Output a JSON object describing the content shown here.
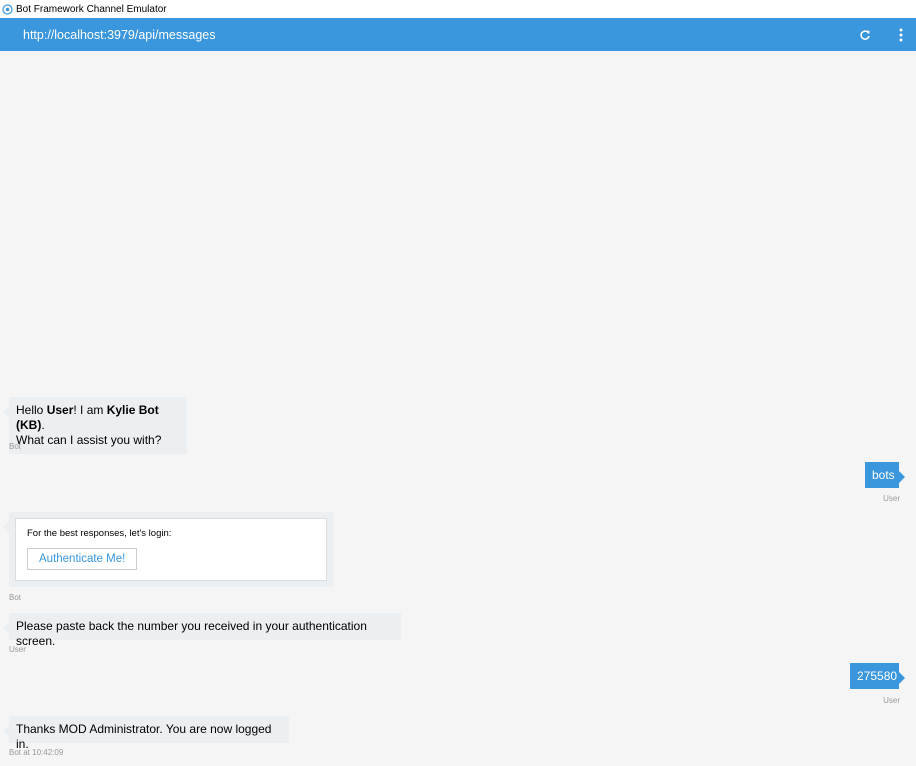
{
  "window": {
    "title": "Bot Framework Channel Emulator",
    "icon": "bot-framework-icon"
  },
  "address": {
    "url": "http://localhost:3979/api/messages",
    "refresh_icon": "refresh-icon",
    "menu_icon": "more-vertical-icon"
  },
  "colors": {
    "accent": "#3a96dd",
    "bot_bubble": "#eceff1",
    "background": "#f5f5f5"
  },
  "messages": {
    "m1": {
      "part1": "Hello ",
      "user": "User",
      "part2": "! I am ",
      "bot": "Kylie Bot (KB)",
      "part3": ".",
      "line2": "What can I assist you with?",
      "meta": "Bot"
    },
    "m2": {
      "text": "bots",
      "meta": "User"
    },
    "m3": {
      "card_text": "For the best responses, let's login:",
      "button": "Authenticate Me!",
      "meta": "Bot"
    },
    "m4": {
      "text": "Please paste back the number you received in your authentication screen.",
      "meta": "User"
    },
    "m5": {
      "text": "275580",
      "meta": "User"
    },
    "m6": {
      "text": "Thanks MOD Administrator. You are now logged in.",
      "meta": "Bot at 10:42:09"
    }
  }
}
